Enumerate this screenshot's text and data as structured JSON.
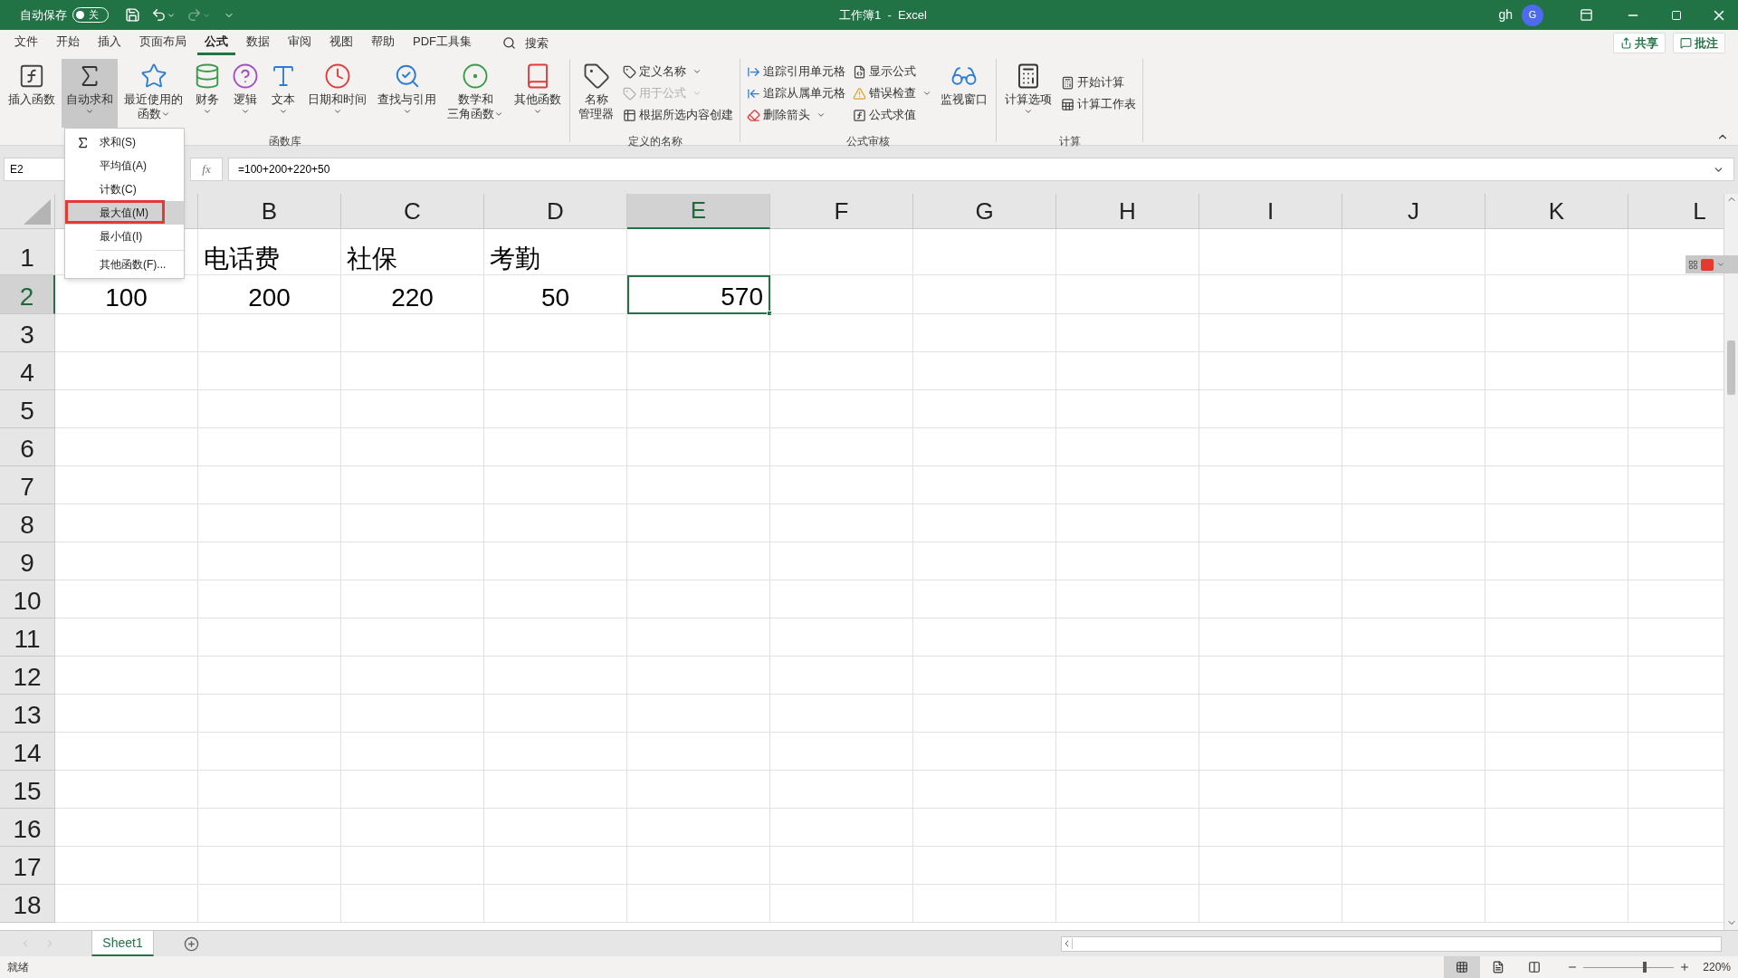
{
  "title_bar": {
    "autosave_label": "自动保存",
    "autosave": {
      "on": false,
      "label": "关"
    },
    "title": "工作簿1  -  Excel",
    "user": "gh",
    "avatar_initial": "G"
  },
  "menu_tabs": [
    {
      "label": "文件",
      "selected": false
    },
    {
      "label": "开始",
      "selected": false
    },
    {
      "label": "插入",
      "selected": false
    },
    {
      "label": "页面布局",
      "selected": false
    },
    {
      "label": "公式",
      "selected": true
    },
    {
      "label": "数据",
      "selected": false
    },
    {
      "label": "审阅",
      "selected": false
    },
    {
      "label": "视图",
      "selected": false
    },
    {
      "label": "帮助",
      "selected": false
    },
    {
      "label": "PDF工具集",
      "selected": false
    }
  ],
  "search": {
    "label": "搜索"
  },
  "share_button": "共享",
  "comments_button": "批注",
  "ribbon_groups": [
    {
      "label": "函数库",
      "items": [
        {
          "kind": "large",
          "lines": [
            "插入函数"
          ],
          "dropdown": false,
          "pressed": false
        },
        {
          "kind": "large",
          "lines": [
            "自动求和"
          ],
          "dropdown": true,
          "pressed": true
        },
        {
          "kind": "large",
          "lines": [
            "最近使用的",
            "函数"
          ],
          "dropdown": true,
          "pressed": false
        },
        {
          "kind": "large",
          "lines": [
            "财务"
          ],
          "dropdown": true,
          "pressed": false
        },
        {
          "kind": "large",
          "lines": [
            "逻辑"
          ],
          "dropdown": true,
          "pressed": false
        },
        {
          "kind": "large",
          "lines": [
            "文本"
          ],
          "dropdown": true,
          "pressed": false
        },
        {
          "kind": "large",
          "lines": [
            "日期和时间"
          ],
          "dropdown": true,
          "pressed": false
        },
        {
          "kind": "large",
          "lines": [
            "查找与引用"
          ],
          "dropdown": true,
          "pressed": false
        },
        {
          "kind": "large",
          "lines": [
            "数学和",
            "三角函数"
          ],
          "dropdown": true,
          "pressed": false
        },
        {
          "kind": "large",
          "lines": [
            "其他函数"
          ],
          "dropdown": true,
          "pressed": false
        }
      ]
    },
    {
      "label": "定义的名称",
      "items": [
        {
          "kind": "large",
          "lines": [
            "名称",
            "管理器"
          ],
          "dropdown": false,
          "pressed": false
        },
        {
          "kind": "column",
          "buttons": [
            {
              "label": "定义名称",
              "dropdown": true,
              "disabled": false
            },
            {
              "label": "用于公式",
              "dropdown": true,
              "disabled": true
            },
            {
              "label": "根据所选内容创建",
              "dropdown": false,
              "disabled": false
            }
          ]
        }
      ]
    },
    {
      "label": "公式审核",
      "items": [
        {
          "kind": "column",
          "buttons": [
            {
              "label": "追踪引用单元格",
              "dropdown": false,
              "disabled": false
            },
            {
              "label": "追踪从属单元格",
              "dropdown": false,
              "disabled": false
            },
            {
              "label": "删除箭头",
              "dropdown": true,
              "disabled": false
            }
          ]
        },
        {
          "kind": "column",
          "buttons": [
            {
              "label": "显示公式",
              "dropdown": false,
              "disabled": false
            },
            {
              "label": "错误检查",
              "dropdown": true,
              "disabled": false
            },
            {
              "label": "公式求值",
              "dropdown": false,
              "disabled": false
            }
          ]
        },
        {
          "kind": "large",
          "lines": [
            "监视窗口"
          ],
          "dropdown": false,
          "pressed": false
        }
      ]
    },
    {
      "label": "计算",
      "items": [
        {
          "kind": "large",
          "lines": [
            "计算选项"
          ],
          "dropdown": true,
          "pressed": false
        },
        {
          "kind": "column",
          "buttons": [
            {
              "label": "开始计算",
              "dropdown": false,
              "disabled": false
            },
            {
              "label": "计算工作表",
              "dropdown": false,
              "disabled": false
            }
          ]
        }
      ]
    }
  ],
  "autosum_menu": [
    {
      "kind": "item",
      "label": "求和(S)",
      "selected": false
    },
    {
      "kind": "item",
      "label": "平均值(A)",
      "selected": false
    },
    {
      "kind": "item",
      "label": "计数(C)",
      "selected": false
    },
    {
      "kind": "item",
      "label": "最大值(M)",
      "selected": true
    },
    {
      "kind": "item",
      "label": "最小值(I)",
      "selected": false
    },
    {
      "kind": "separator"
    },
    {
      "kind": "item",
      "label": "其他函数(F)...",
      "selected": false
    }
  ],
  "formula_bar": {
    "name_box": "E2",
    "fx": "fx",
    "formula": "=100+200+220+50"
  },
  "sheet": {
    "columns": [
      {
        "selected": false
      },
      {
        "label": "B",
        "selected": false
      },
      {
        "label": "C",
        "selected": false
      },
      {
        "label": "D",
        "selected": false
      },
      {
        "label": "E",
        "selected": true
      },
      {
        "label": "F",
        "selected": false
      },
      {
        "label": "G",
        "selected": false
      },
      {
        "label": "H",
        "selected": false
      },
      {
        "label": "I",
        "selected": false
      },
      {
        "label": "J",
        "selected": false
      },
      {
        "label": "K",
        "selected": false
      },
      {
        "label": "L",
        "selected": false
      }
    ],
    "rows": [
      {
        "label": "1",
        "selected": false,
        "cells": [
          {
            "active": false
          },
          {
            "kind": "text",
            "value": "电话费",
            "active": false
          },
          {
            "kind": "text",
            "value": "社保",
            "active": false
          },
          {
            "kind": "text",
            "value": "考勤",
            "active": false
          },
          {
            "active": false
          },
          {
            "active": false
          },
          {
            "active": false
          },
          {
            "active": false
          },
          {
            "active": false
          },
          {
            "active": false
          },
          {
            "active": false
          },
          {
            "active": false
          }
        ]
      },
      {
        "label": "2",
        "selected": true,
        "cells": [
          {
            "kind": "centered",
            "value": "100",
            "active": false
          },
          {
            "kind": "centered",
            "value": "200",
            "active": false
          },
          {
            "kind": "centered",
            "value": "220",
            "active": false
          },
          {
            "kind": "centered",
            "value": "50",
            "active": false
          },
          {
            "kind": "number",
            "value": "570",
            "active": true
          },
          {
            "active": false
          },
          {
            "active": false
          },
          {
            "active": false
          },
          {
            "active": false
          },
          {
            "active": false
          },
          {
            "active": false
          },
          {
            "active": false
          }
        ]
      },
      {
        "label": "3",
        "selected": false
      },
      {
        "label": "4",
        "selected": false
      },
      {
        "label": "5",
        "selected": false
      },
      {
        "label": "6",
        "selected": false
      },
      {
        "label": "7",
        "selected": false
      },
      {
        "label": "8",
        "selected": false
      },
      {
        "label": "9",
        "selected": false
      },
      {
        "label": "10",
        "selected": false
      },
      {
        "label": "11",
        "selected": false
      },
      {
        "label": "12",
        "selected": false
      },
      {
        "label": "13",
        "selected": false
      },
      {
        "label": "14",
        "selected": false
      },
      {
        "label": "15",
        "selected": false
      },
      {
        "label": "16",
        "selected": false
      },
      {
        "label": "17",
        "selected": false
      },
      {
        "label": "18",
        "selected": false
      }
    ]
  },
  "sheet_tabs": [
    {
      "label": "Sheet1",
      "selected": true
    }
  ],
  "status_bar": {
    "status": "就绪",
    "views": [
      {
        "selected": true
      },
      {
        "selected": false
      },
      {
        "selected": false
      }
    ],
    "zoom": {
      "level": 0.68,
      "label": "220%"
    }
  }
}
